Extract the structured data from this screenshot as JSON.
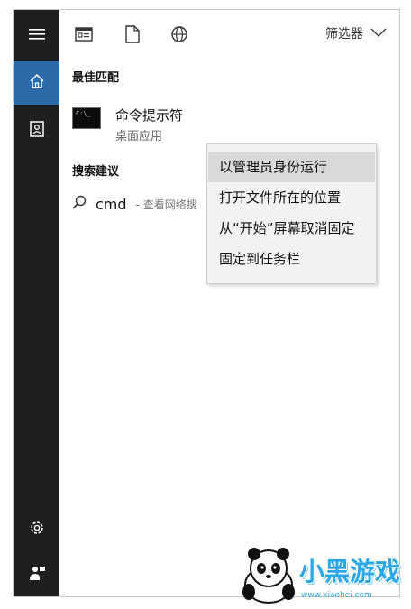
{
  "topbar": {
    "filter_label": "筛选器",
    "icons": [
      "document-grid-icon",
      "document-icon",
      "globe-icon"
    ]
  },
  "best_match": {
    "title": "最佳匹配",
    "app_name": "命令提示符",
    "app_sub": "桌面应用",
    "app_icon_text": "C:\\_"
  },
  "suggestions": {
    "title": "搜索建议",
    "query": "cmd",
    "hint": "- 查看网络搜"
  },
  "context_menu": {
    "items": [
      "以管理员身份运行",
      "打开文件所在的位置",
      "从“开始”屏幕取消固定",
      "固定到任务栏"
    ]
  },
  "rail": {
    "icons": [
      "menu-icon",
      "home-icon",
      "notebook-icon",
      "settings-icon",
      "feedback-icon"
    ]
  },
  "watermark": {
    "text": "小黑游戏",
    "url": "www.xiaohei.com"
  },
  "colors": {
    "rail_bg": "#1f1f1f",
    "rail_active": "#2d6ba8",
    "menu_bg": "#f2f2f2",
    "menu_hover": "#d9d9d9",
    "watermark": "#29a7e6"
  }
}
